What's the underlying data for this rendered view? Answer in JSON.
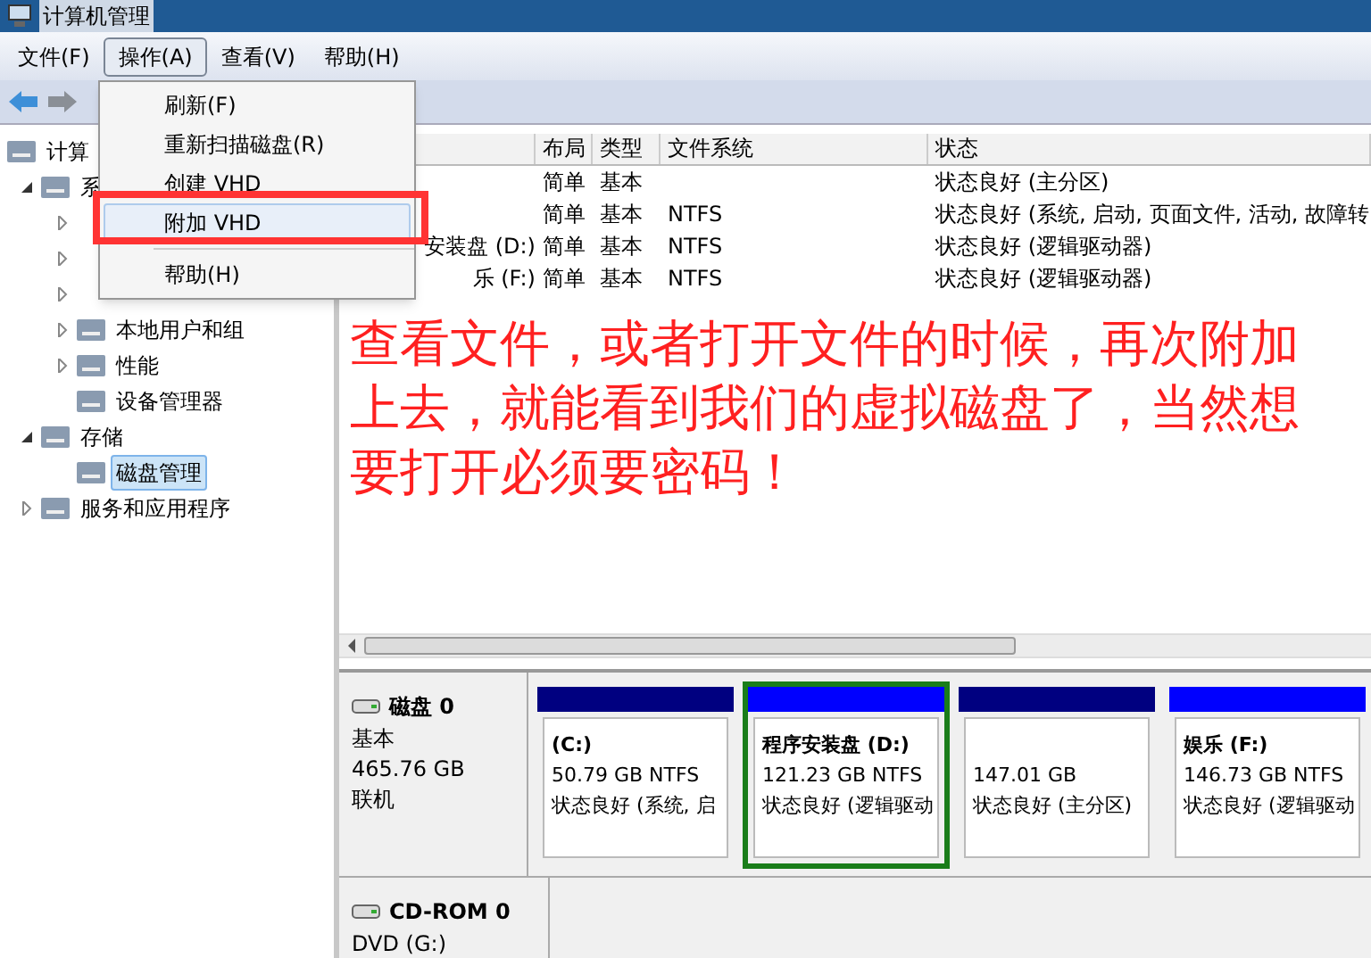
{
  "window": {
    "title": "计算机管理"
  },
  "menu_bar": [
    {
      "label": "文件(F)",
      "selected": false
    },
    {
      "label": "操作(A)",
      "selected": true
    },
    {
      "label": "查看(V)",
      "selected": false
    },
    {
      "label": "帮助(H)",
      "selected": false
    }
  ],
  "action_menu": {
    "items": [
      {
        "kind": "item",
        "label": "刷新(F)",
        "selected": false
      },
      {
        "kind": "item",
        "label": "重新扫描磁盘(R)",
        "selected": false
      },
      {
        "kind": "item",
        "label": "创建 VHD",
        "selected": false
      },
      {
        "kind": "item",
        "label": "附加 VHD",
        "selected": true
      },
      {
        "kind": "separator"
      },
      {
        "kind": "item",
        "label": "帮助(H)",
        "selected": false
      }
    ]
  },
  "tree": [
    {
      "label": "计算",
      "selected": false,
      "children": [
        {
          "label": "系",
          "expanded": true,
          "selected": false,
          "children": [
            {
              "expanded": false
            },
            {
              "expanded": false
            },
            {
              "expanded": false
            },
            {
              "label": "本地用户和组",
              "expanded": false,
              "selected": false
            },
            {
              "label": "性能",
              "expanded": false,
              "selected": false
            },
            {
              "label": "设备管理器",
              "selected": false
            }
          ]
        },
        {
          "label": "存储",
          "expanded": true,
          "selected": false,
          "children": [
            {
              "label": "磁盘管理",
              "selected": true
            }
          ]
        },
        {
          "label": "服务和应用程序",
          "expanded": false,
          "selected": false
        }
      ]
    }
  ],
  "table": {
    "columns": [
      "布局",
      "类型",
      "文件系统",
      "状态"
    ],
    "rows": [
      {
        "layout": "简单",
        "type": "基本",
        "status": "状态良好 (主分区)"
      },
      {
        "layout": "简单",
        "type": "基本",
        "fs": "NTFS",
        "status": "状态良好 (系统, 启动, 页面文件, 活动, 故障转"
      },
      {
        "volume": "安装盘 (D:)",
        "layout": "简单",
        "type": "基本",
        "fs": "NTFS",
        "status": "状态良好 (逻辑驱动器)"
      },
      {
        "volume": "乐 (F:)",
        "layout": "简单",
        "type": "基本",
        "fs": "NTFS",
        "status": "状态良好 (逻辑驱动器)"
      }
    ]
  },
  "annotation": "查看文件，或者打开文件的时候，再次附加上去，就能看到我们的虚拟磁盘了，当然想要打开必须要密码！",
  "disks": [
    {
      "name": "磁盘 0",
      "lines": [
        "基本",
        "465.76 GB",
        "联机"
      ],
      "partitions": [
        {
          "title": "(C:)",
          "size": "50.79 GB NTFS",
          "status": "状态良好 (系统, 启",
          "color": "#000080",
          "selected": false
        },
        {
          "title": "程序安装盘 (D:)",
          "size": "121.23 GB NTFS",
          "status": "状态良好 (逻辑驱动",
          "color": "#0000ff",
          "selected": true
        },
        {
          "size": "147.01 GB",
          "status": "状态良好 (主分区)",
          "color": "#000080",
          "selected": false
        },
        {
          "title": "娱乐 (F:)",
          "size": "146.73 GB NTFS",
          "status": "状态良好 (逻辑驱动",
          "color": "#0000ff",
          "selected": false
        }
      ]
    },
    {
      "name": "CD-ROM 0",
      "lines": [
        "DVD (G:)"
      ]
    }
  ]
}
